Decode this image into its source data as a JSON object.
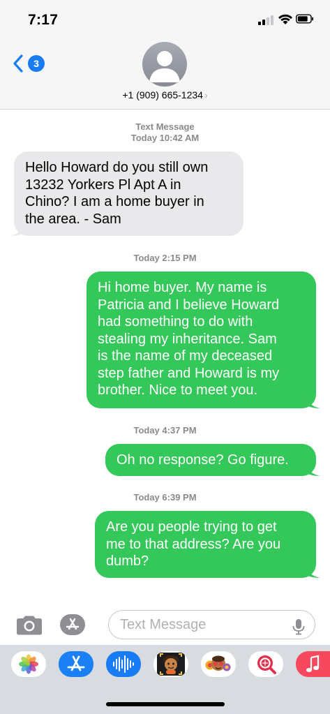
{
  "status_bar": {
    "time": "7:17"
  },
  "header": {
    "back_badge": "3",
    "contact": "+1 (909) 665-1234",
    "chevron": "›"
  },
  "messages": [
    {
      "type": "timestamp",
      "label": "Text Message",
      "time": "Today 10:42 AM"
    },
    {
      "type": "received",
      "text": "Hello Howard do you still own\n13232 Yorkers Pl Apt A in\nChino? I am a home buyer in\nthe area. - Sam"
    },
    {
      "type": "timestamp",
      "time": "Today 2:15 PM"
    },
    {
      "type": "sent",
      "text": "Hi home buyer. My name is\nPatricia and I believe Howard\nhad something to do with\nstealing my inheritance. Sam\nis the name of my deceased\nstep father and Howard is my\nbrother. Nice to meet you."
    },
    {
      "type": "timestamp",
      "time": "Today 4:37 PM"
    },
    {
      "type": "sent",
      "text": "Oh no response? Go figure."
    },
    {
      "type": "timestamp",
      "time": "Today 6:39 PM"
    },
    {
      "type": "sent",
      "text": "Are you people trying to get\nme to that address? Are you\ndumb?"
    }
  ],
  "input_bar": {
    "placeholder": "Text Message"
  },
  "app_tray": {
    "apps": [
      "photos-icon",
      "app-store-icon",
      "audio-message-icon",
      "memoji-icon",
      "animoji-icon",
      "search-images-icon",
      "music-icon"
    ]
  },
  "colors": {
    "sent_bubble": "#34c759",
    "received_bubble": "#e9e9eb",
    "accent": "#1a7cf5"
  }
}
